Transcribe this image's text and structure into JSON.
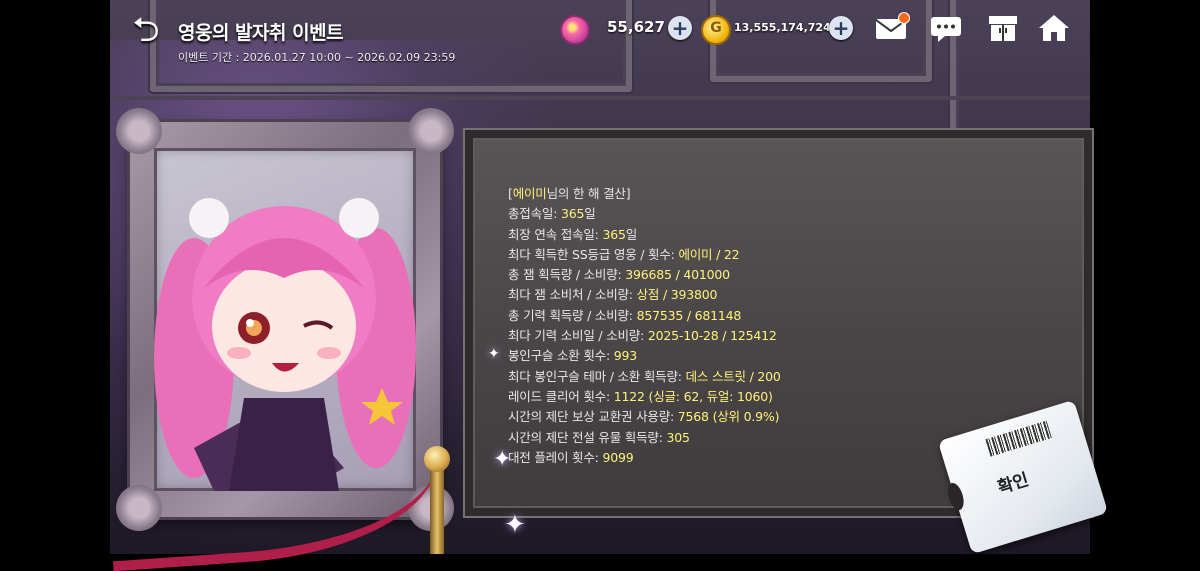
{
  "header": {
    "title": "영웅의 발자취 이벤트",
    "period": "이벤트 기간 : 2026.01.27 10:00 ~ 2026.02.09 23:59"
  },
  "currency": {
    "gem_value": "55,627",
    "gold_value": "13,555,174,724",
    "gold_symbol": "G"
  },
  "stats": {
    "nickname": "에이미",
    "heading_suffix": "님의 한 해 결산]",
    "lines": [
      {
        "label": "총접속일: ",
        "value": "365",
        "suffix": "일"
      },
      {
        "label": "최장 연속 접속일: ",
        "value": "365",
        "suffix": "일"
      },
      {
        "label": "최다 획득한 SS등급 영웅 / 횟수: ",
        "value": "에이미 / 22",
        "suffix": ""
      },
      {
        "label": "총 잼 획득량 / 소비량: ",
        "value": "396685 / 401000",
        "suffix": ""
      },
      {
        "label": "최다 잼 소비처 / 소비량: ",
        "value": "상점 / 393800",
        "suffix": ""
      },
      {
        "label": "총 기력 획득량 / 소비량: ",
        "value": "857535 / 681148",
        "suffix": ""
      },
      {
        "label": "최다 기력 소비일 / 소비량: ",
        "value": "2025-10-28 / 125412",
        "suffix": ""
      },
      {
        "label": "봉인구슬 소환 횟수: ",
        "value": "993",
        "suffix": ""
      },
      {
        "label": "최다 봉인구슬 테마 / 소환 획득량: ",
        "value": "데스 스트릿 / 200",
        "suffix": ""
      },
      {
        "label": "레이드 클리어 횟수: ",
        "value": "1122 (싱글: 62, 듀얼: 1060)",
        "suffix": ""
      },
      {
        "label": "시간의 제단 보상 교환권 사용량: ",
        "value": "7568 (상위 0.9%)",
        "suffix": ""
      },
      {
        "label": "시간의 제단 전설 유물 획득량: ",
        "value": "305",
        "suffix": ""
      },
      {
        "label": "대전 플레이 횟수: ",
        "value": "9099",
        "suffix": ""
      }
    ]
  },
  "confirm": {
    "label": "확인"
  },
  "icons": {
    "back": "back-arrow-icon",
    "gem": "gem-icon",
    "gold": "gold-coin-icon",
    "mail": "mail-icon",
    "chat": "chat-icon",
    "wardrobe": "wardrobe-icon",
    "home": "home-icon"
  },
  "colors": {
    "highlight": "#fff27a",
    "text": "#e9e6ea",
    "notification": "#ff6a1a",
    "rope": "#b01e4a"
  }
}
